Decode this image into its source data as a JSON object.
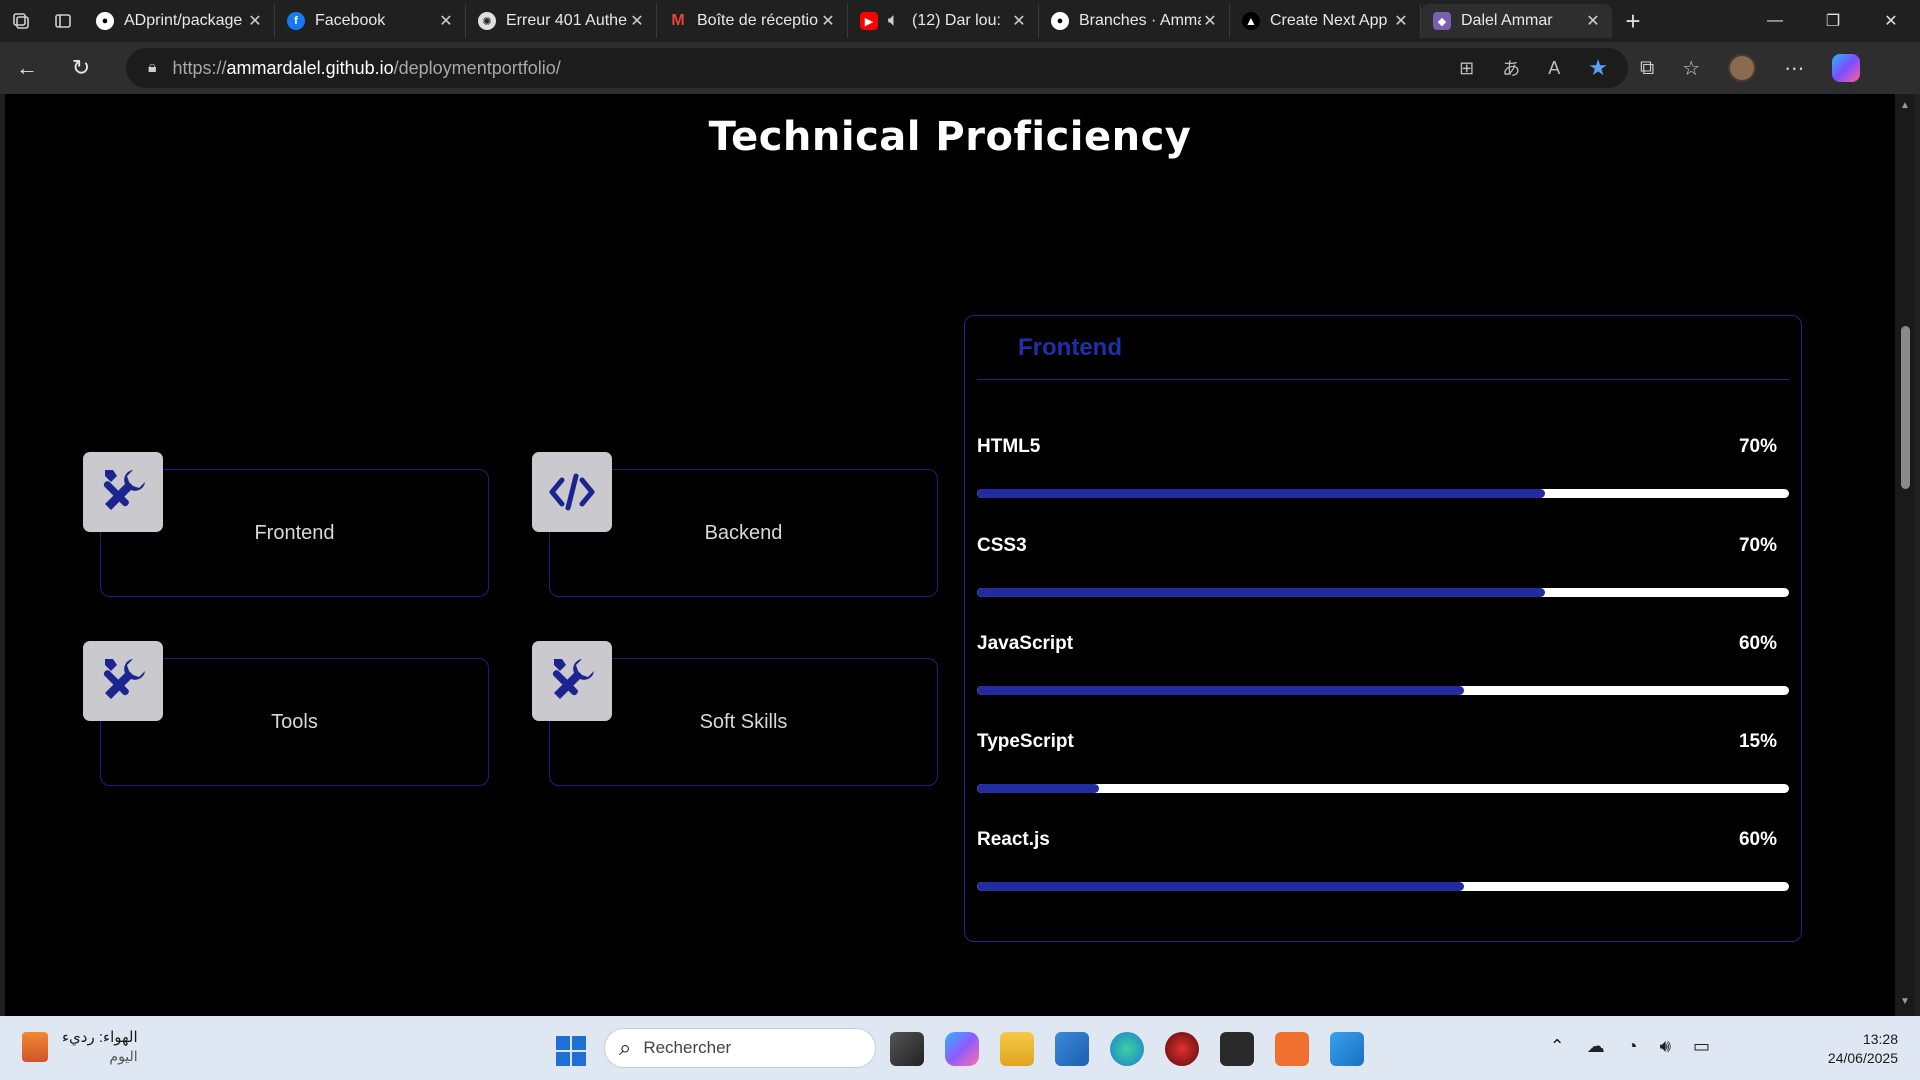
{
  "browser": {
    "tabs": [
      {
        "title": "ADprint/package",
        "icon": "github-icon"
      },
      {
        "title": "Facebook",
        "icon": "facebook-icon"
      },
      {
        "title": "Erreur 401 Auther",
        "icon": "openai-icon"
      },
      {
        "title": "Boîte de réceptio",
        "icon": "gmail-icon"
      },
      {
        "title": "(12) Dar lou:",
        "icon": "youtube-icon"
      },
      {
        "title": "Branches · Amma",
        "icon": "github-icon"
      },
      {
        "title": "Create Next App",
        "icon": "vercel-icon"
      },
      {
        "title": "Dalel Ammar",
        "icon": "portfolio-icon",
        "active": true
      }
    ],
    "url": {
      "scheme": "https://",
      "host": "ammardalel.github.io",
      "path": "/deploymentportfolio/"
    }
  },
  "page": {
    "title": "Technical Proficiency",
    "categories": [
      {
        "label": "Frontend",
        "icon": "tools-icon"
      },
      {
        "label": "Backend",
        "icon": "code-icon"
      },
      {
        "label": "Tools",
        "icon": "tools-icon"
      },
      {
        "label": "Soft Skills",
        "icon": "tools-icon"
      }
    ],
    "panel": {
      "title": "Frontend",
      "skills": [
        {
          "name": "HTML5",
          "percent_label": "70%",
          "level": 70
        },
        {
          "name": "CSS3",
          "percent_label": "70%",
          "level": 70
        },
        {
          "name": "JavaScript",
          "percent_label": "60%",
          "level": 60
        },
        {
          "name": "TypeScript",
          "percent_label": "15%",
          "level": 15
        },
        {
          "name": "React.js",
          "percent_label": "60%",
          "level": 60
        }
      ]
    }
  },
  "taskbar": {
    "weather_line1": "الهواء: رديء",
    "weather_line2": "اليوم",
    "search_placeholder": "Rechercher",
    "time": "13:28",
    "date": "24/06/2025"
  },
  "colors": {
    "accent": "#232ba0",
    "panel_border": "#23238c",
    "panel_title": "#1f2fa8",
    "background": "#000000"
  }
}
